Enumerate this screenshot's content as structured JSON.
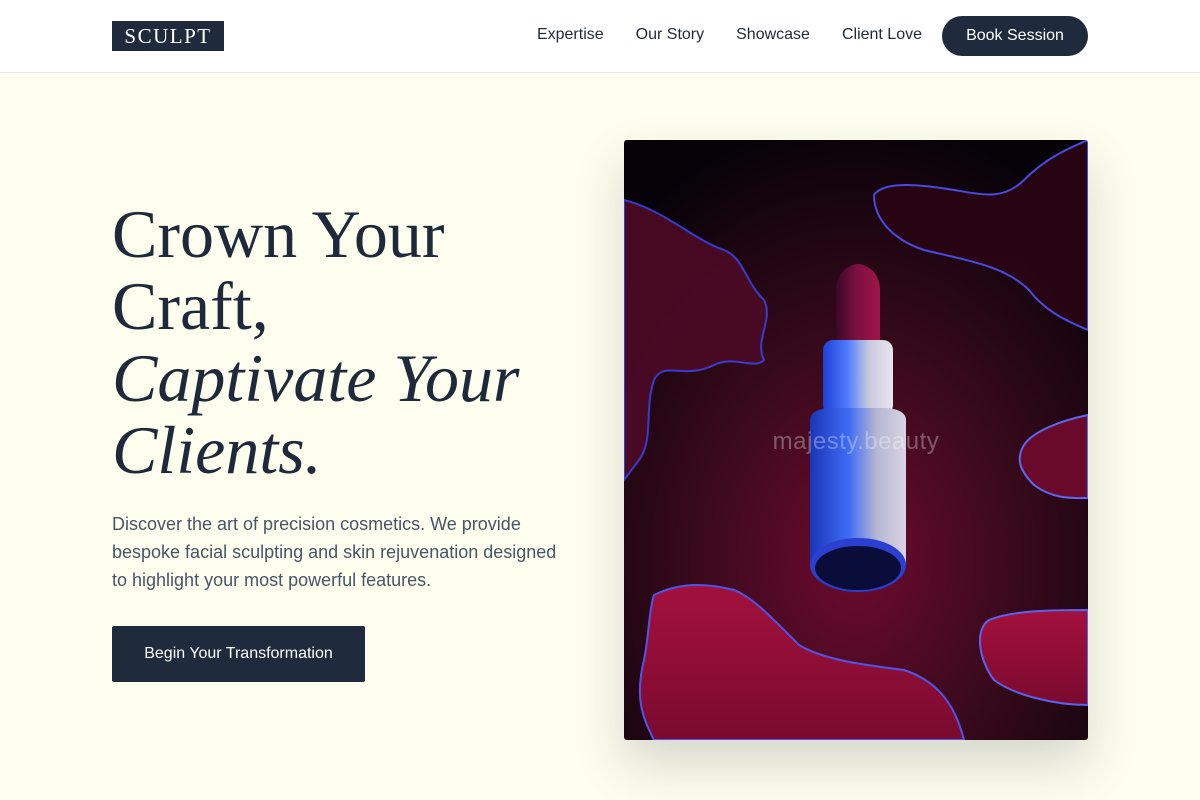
{
  "nav": {
    "logo": "SCULPT",
    "links": [
      "Expertise",
      "Our Story",
      "Showcase",
      "Client Love"
    ],
    "cta": "Book Session"
  },
  "hero": {
    "title_line1": "Crown Your",
    "title_line2": "Craft,",
    "title_line3": "Captivate Your",
    "title_line4": "Clients.",
    "description": "Discover the art of precision cosmetics. We provide bespoke facial sculpting and skin rejuvenation designed to highlight your most powerful features.",
    "cta": "Begin Your Transformation",
    "image_watermark": "majesty.beauty"
  },
  "colors": {
    "background": "#fefeee",
    "navy": "#1f2a3c",
    "text": "#1e293b",
    "muted": "#475569"
  }
}
